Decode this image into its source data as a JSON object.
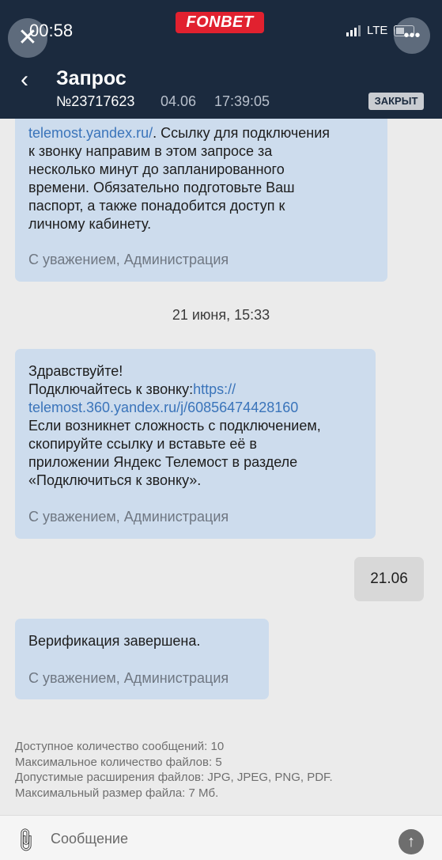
{
  "status_bar": {
    "time": "00:58",
    "network": "LTE",
    "brand": "FONBET"
  },
  "header": {
    "title": "Запрос",
    "request_number": "№23717623",
    "date": "04.06",
    "time": "17:39:05",
    "status_badge": "ЗАКРЫТ"
  },
  "messages": [
    {
      "lines": [
        "telemost.yandex.ru/",
        ". Ссылку для подключения",
        "к звонку направим в этом запросе за",
        "несколько минут до запланированного",
        "времени. Обязательно подготовьте Ваш",
        "паспорт, а также понадобится доступ к",
        "личному кабинету."
      ],
      "signature": "С уважением, Администрация"
    },
    {
      "date_separator": "21 июня, 15:33",
      "lines": [
        "Здравствуйте!",
        "Подключайтесь к звонку:",
        "https://",
        "telemost.360.yandex.ru/j/60856474428160",
        "Если возникнет сложность с подключением,",
        "скопируйте ссылку и вставьте её в",
        "приложении Яндекс Телемост в разделе",
        "«Подключиться к звонку»."
      ],
      "signature": "С уважением, Администрация"
    },
    {
      "user_text": "21.06"
    },
    {
      "lines": [
        "Верификация завершена."
      ],
      "signature": "С уважением, Администрация"
    }
  ],
  "limits": [
    "Доступное количество сообщений: 10",
    "Максимальное количество файлов: 5",
    "Допустимые расширения файлов: JPG, JPEG, PNG, PDF.",
    "Максимальный размер файла: 7 Мб."
  ],
  "composer": {
    "placeholder": "Сообщение"
  },
  "icons": {
    "close": "close-icon",
    "back": "back-chevron-icon",
    "attach": "paperclip-icon",
    "send": "send-arrow-icon"
  },
  "colors": {
    "header_bg": "#1b2a3e",
    "brand_red": "#e1212f",
    "bubble": "#cddced",
    "link": "#3a74ba"
  }
}
